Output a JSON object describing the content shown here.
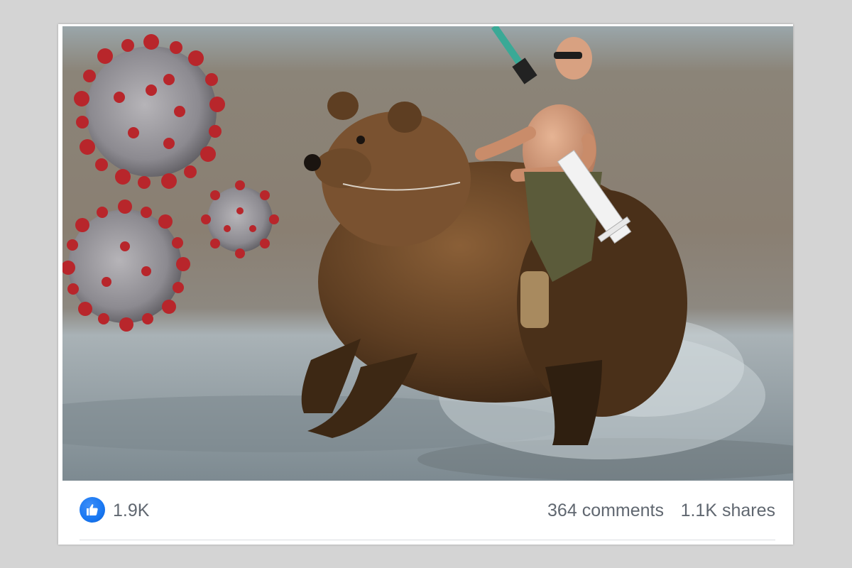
{
  "post": {
    "image_alt": "",
    "reactions": {
      "icon": "like-thumbs-up-icon",
      "icon_color": "#1877f2",
      "count": "1.9K"
    },
    "comments": "364 comments",
    "shares": "1.1K shares"
  },
  "colors": {
    "background": "#d4d4d4",
    "card": "#ffffff",
    "meta_text": "#606770",
    "accent": "#1877f2"
  }
}
